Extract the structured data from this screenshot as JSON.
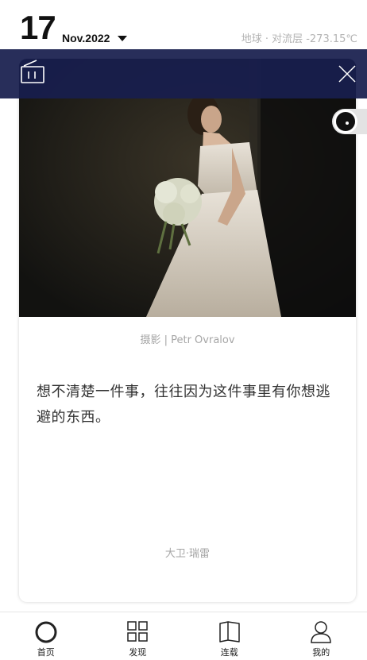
{
  "header": {
    "day": "17",
    "month_year": "Nov.2022",
    "weather": "地球 · 对流层  -273.15℃"
  },
  "overlay": {
    "left_icon": "radio-icon",
    "right_icon": "close-icon",
    "background_color": "#181e4e"
  },
  "card": {
    "photo_credit": "摄影 | Petr Ovralov",
    "quote": "想不清楚一件事，往往因为这件事里有你想逃避的东西。",
    "author": "大卫·瑞雷"
  },
  "floating_toggle": {
    "icon": "toggle-knob-icon"
  },
  "tabs": [
    {
      "label": "首页",
      "icon": "home-circle-icon"
    },
    {
      "label": "发现",
      "icon": "grid-icon"
    },
    {
      "label": "连载",
      "icon": "book-icon"
    },
    {
      "label": "我的",
      "icon": "user-icon"
    }
  ]
}
